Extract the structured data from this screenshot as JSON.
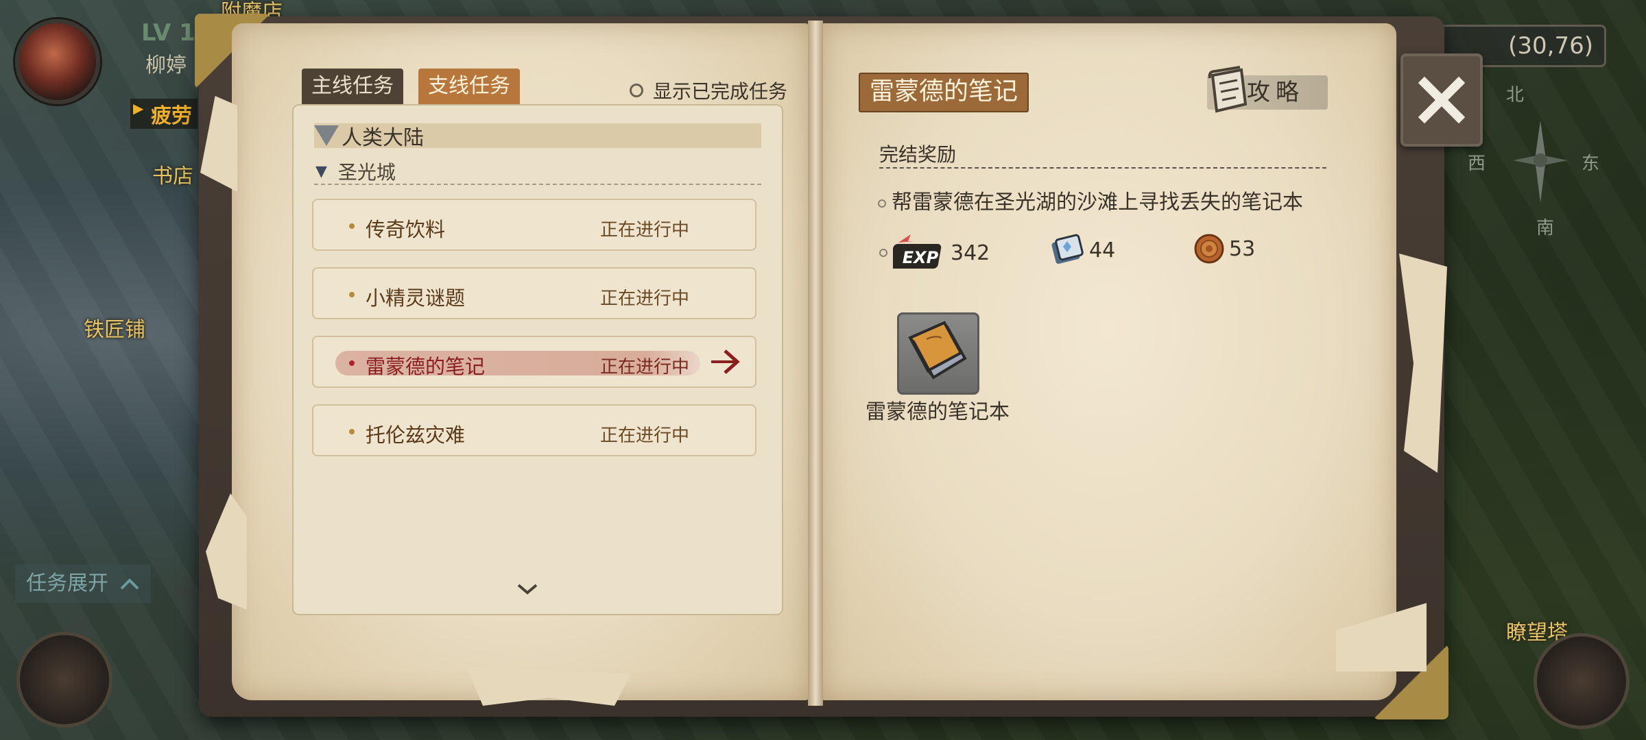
{
  "map": {
    "labels": [
      "附魔店",
      "书店",
      "铁匠铺",
      "瞭望塔"
    ],
    "player": {
      "level": "LV 1",
      "name": "柳婷",
      "status": "疲劳"
    },
    "coordinates": "(30,76)",
    "compass": {
      "north": "北",
      "south": "南",
      "west": "西",
      "east": "东"
    },
    "task_expand_label": "任务展开"
  },
  "tabs": {
    "main": "主线任务",
    "side": "支线任务",
    "active": "支线任务"
  },
  "show_completed_label": "显示已完成任务",
  "region": "人类大陆",
  "city": "圣光城",
  "quests": [
    {
      "name": "传奇饮料",
      "status": "正在进行中"
    },
    {
      "name": "小精灵谜题",
      "status": "正在进行中"
    },
    {
      "name": "雷蒙德的笔记",
      "status": "正在进行中",
      "selected": true
    },
    {
      "name": "托伦兹灾难",
      "status": "正在进行中"
    }
  ],
  "detail": {
    "title": "雷蒙德的笔记",
    "guide_label": "攻略",
    "reward_title": "完结奖励",
    "objective": "帮雷蒙德在圣光湖的沙滩上寻找丢失的笔记本",
    "rewards": [
      {
        "icon": "exp-icon",
        "label": "EXP",
        "value": "342"
      },
      {
        "icon": "crystal-card-icon",
        "value": "44"
      },
      {
        "icon": "coin-icon",
        "value": "53"
      }
    ],
    "item": {
      "name": "雷蒙德的笔记本",
      "icon": "notebook-icon"
    }
  },
  "colors": {
    "active_tab": "#b7763c",
    "inactive_tab": "#4d4233",
    "selected_quest": "#8a1e1e",
    "title_badge": "#9b6a38"
  }
}
